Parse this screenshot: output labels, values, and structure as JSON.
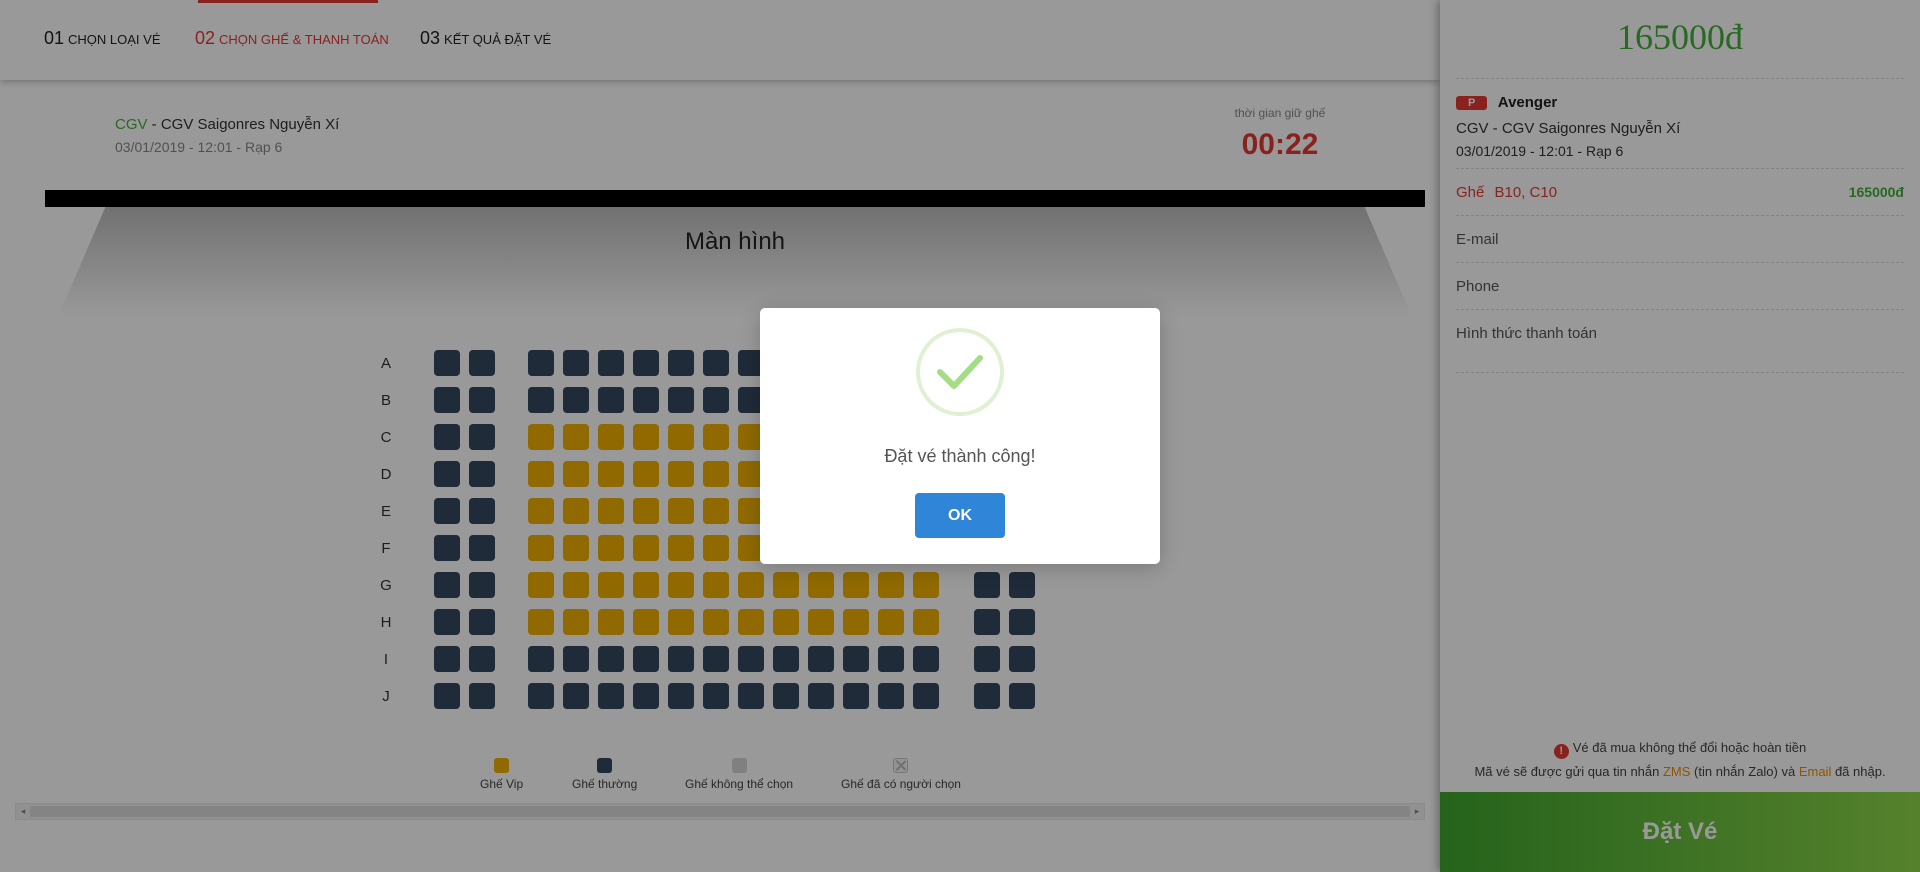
{
  "steps": [
    {
      "num": "01",
      "label": "Chọn loại vé"
    },
    {
      "num": "02",
      "label": "Chọn ghế & thanh toán"
    },
    {
      "num": "03",
      "label": "Kết quả đặt vé"
    }
  ],
  "cinema": {
    "brand": "CGV",
    "name": " - CGV Saigonres Nguyễn Xí",
    "time": "03/01/2019 - 12:01 - Rạp 6"
  },
  "hold": {
    "label": "thời gian giữ ghế",
    "timer": "00:22"
  },
  "screen_label": "Màn hình",
  "seatmap": {
    "rows": [
      "A",
      "B",
      "C",
      "D",
      "E",
      "F",
      "G",
      "H",
      "I",
      "J"
    ],
    "seats_per_row": 16,
    "vip_rows": [
      "C",
      "D",
      "E",
      "F",
      "G",
      "H"
    ],
    "vip_seat_range": [
      3,
      14
    ],
    "colors": {
      "vip": "#f1b101",
      "normal": "#34495e"
    }
  },
  "legend": [
    {
      "type": "vip",
      "label": "Ghế Vip"
    },
    {
      "type": "normal",
      "label": "Ghế thường"
    },
    {
      "type": "unavail",
      "label": "Ghế không thể chọn"
    },
    {
      "type": "taken",
      "label": "Ghế đã có người chọn"
    }
  ],
  "sidebar": {
    "total_price": "165000đ",
    "rating": "P",
    "movie_title": "Avenger",
    "cinema": "CGV - CGV Saigonres Nguyễn Xí",
    "time": "03/01/2019 - 12:01 - Rạp 6",
    "seat_label": "Ghế",
    "seat_list": "B10, C10",
    "seat_price": "165000đ",
    "email_placeholder": "E-mail",
    "phone_placeholder": "Phone",
    "payment_label": "Hình thức thanh toán",
    "notice_icon": "!",
    "notice_line1": "Vé đã mua không thể đổi hoặc hoàn tiền",
    "notice_line2_a": "Mã vé sẽ được gửi qua tin nhắn ",
    "notice_zms": "ZMS",
    "notice_line2_b": " (tin nhắn Zalo) và ",
    "notice_email": "Email",
    "notice_line2_c": " đã nhập.",
    "book_button": "Đặt Vé"
  },
  "modal": {
    "icon": "success-check-icon",
    "message": "Đặt vé thành công!",
    "ok_label": "OK"
  },
  "colors": {
    "accent_red": "#e53935",
    "accent_green": "#44b03a",
    "ok_blue": "#2f86d8"
  }
}
